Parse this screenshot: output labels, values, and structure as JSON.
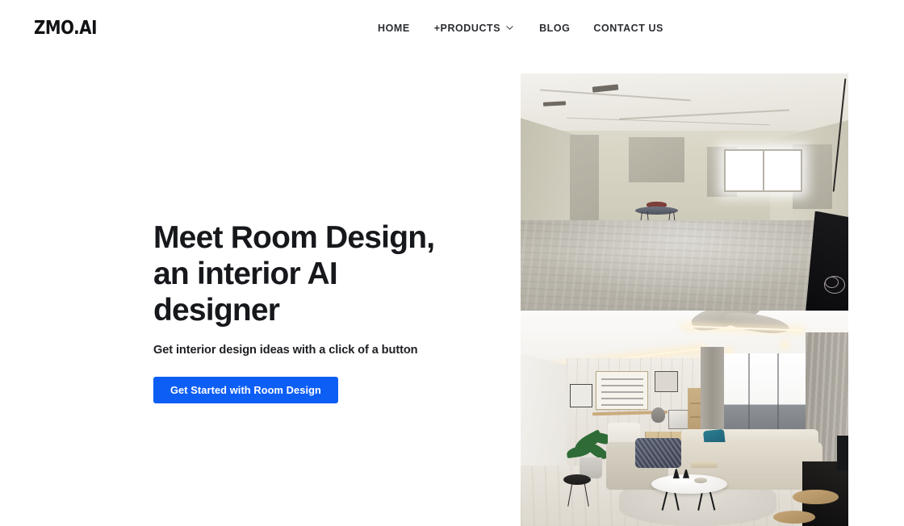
{
  "header": {
    "logo": "ZMO.AI",
    "nav": [
      {
        "label": "HOME",
        "has_dropdown": false,
        "name": "home"
      },
      {
        "label": "+PRODUCTS",
        "has_dropdown": true,
        "name": "products"
      },
      {
        "label": "BLOG",
        "has_dropdown": false,
        "name": "blog"
      },
      {
        "label": "CONTACT US",
        "has_dropdown": false,
        "name": "contact-us"
      }
    ]
  },
  "hero": {
    "headline": "Meet Room Design, an interior AI designer",
    "subheadline": "Get interior design ideas with a click of a button",
    "cta_label": "Get Started with Room Design"
  },
  "media": {
    "before": {
      "alt": "Empty unfinished room with bare concrete floor, unpainted plastered walls, a window and a small folding table"
    },
    "after": {
      "alt": "AI designed modern living room with beige sectional sofa, marble coffee table, plants, curtains and ceiling fan"
    }
  },
  "colors": {
    "accent": "#0d5ef5",
    "text_primary": "#16181c",
    "text_nav": "#2b2d31",
    "background": "#ffffff"
  }
}
